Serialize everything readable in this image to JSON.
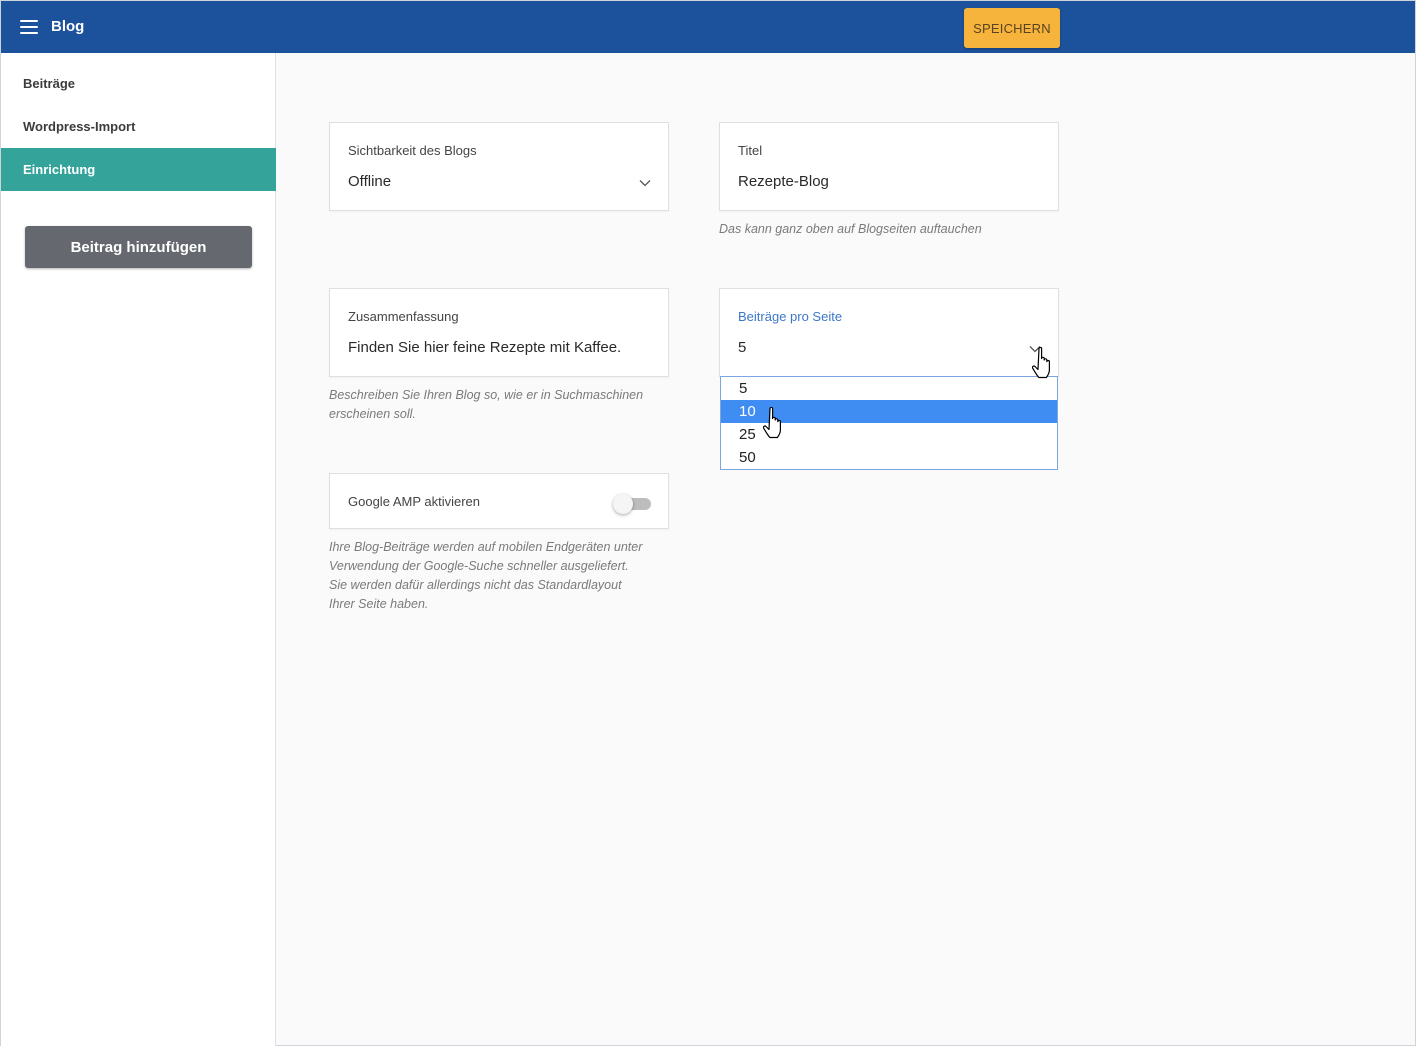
{
  "header": {
    "title": "Blog",
    "save_label": "SPEICHERN",
    "menu_icon": "hamburger-menu-icon"
  },
  "sidebar": {
    "items": [
      {
        "label": "Beiträge",
        "active": false
      },
      {
        "label": "Wordpress-Import",
        "active": false
      },
      {
        "label": "Einrichtung",
        "active": true
      }
    ],
    "add_button_label": "Beitrag hinzufügen"
  },
  "settings": {
    "visibility": {
      "label": "Sichtbarkeit des Blogs",
      "value": "Offline"
    },
    "title": {
      "label": "Titel",
      "value": "Rezepte-Blog",
      "hint": "Das kann ganz oben auf Blogseiten auftauchen"
    },
    "summary": {
      "label": "Zusammenfassung",
      "value": "Finden Sie hier feine Rezepte mit Kaffee.",
      "hint_line1": "Beschreiben Sie Ihren Blog so, wie er in Suchmaschinen",
      "hint_line2": "erscheinen soll."
    },
    "posts_per_page": {
      "label": "Beiträge pro Seite",
      "value": "5",
      "options": [
        "5",
        "10",
        "25",
        "50"
      ],
      "highlighted": "10"
    },
    "amp": {
      "label": "Google AMP aktivieren",
      "enabled": false,
      "hint_line1": "Ihre Blog-Beiträge werden auf mobilen Endgeräten unter",
      "hint_line2": "Verwendung der Google-Suche schneller ausgeliefert.",
      "hint_line3": "Sie werden dafür allerdings nicht das Standardlayout",
      "hint_line4": "Ihrer Seite haben."
    }
  },
  "colors": {
    "topbar": "#1c519b",
    "accent_active": "#34a39a",
    "save_button": "#f6b43c",
    "add_button": "#65686e",
    "dropdown_highlight": "#3f8cf3",
    "focus_label": "#3c78c8"
  }
}
